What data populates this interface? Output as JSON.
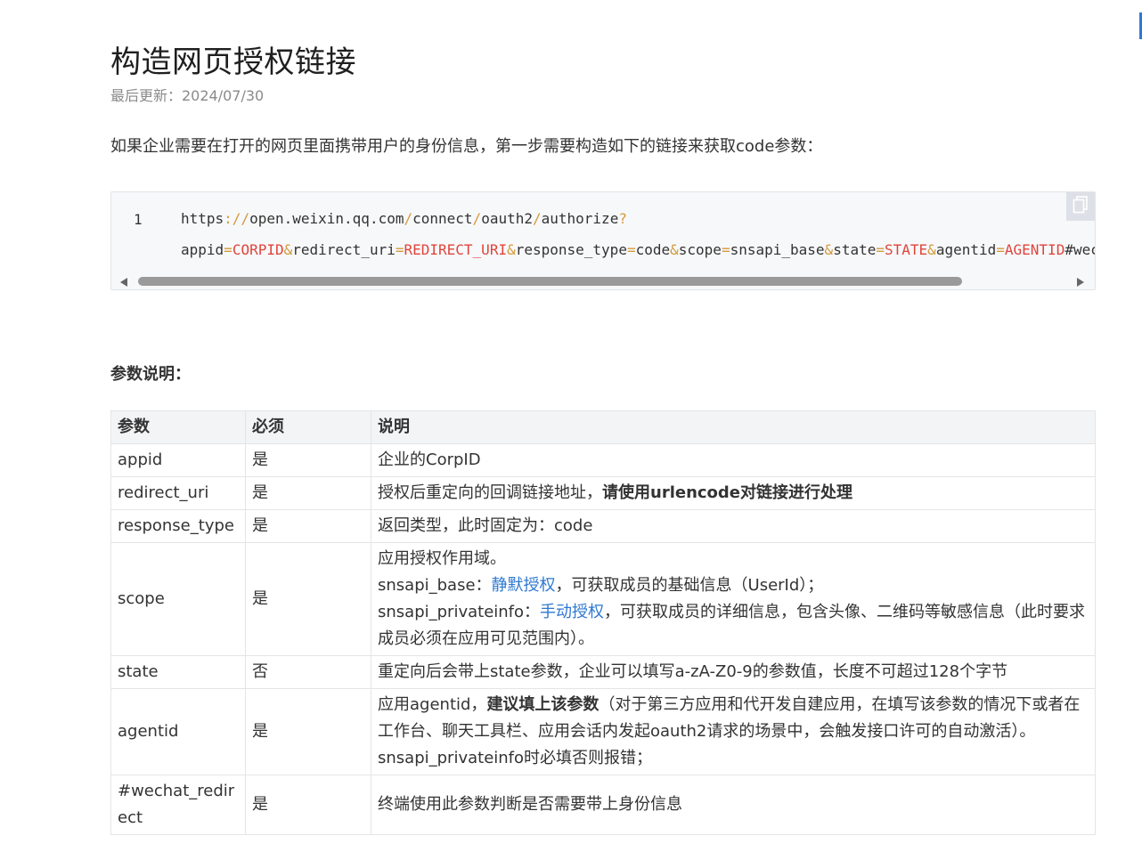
{
  "page": {
    "title": "构造网页授权链接",
    "updated": "最后更新：2024/07/30",
    "intro": "如果企业需要在打开的网页里面携带用户的身份信息，第一步需要构造如下的链接来获取code参数："
  },
  "code": {
    "line_number": "1",
    "line1": [
      {
        "t": "https",
        "k": "n"
      },
      {
        "t": "://",
        "k": "p"
      },
      {
        "t": "open.weixin.qq.com",
        "k": "n"
      },
      {
        "t": "/",
        "k": "p"
      },
      {
        "t": "connect",
        "k": "n"
      },
      {
        "t": "/",
        "k": "p"
      },
      {
        "t": "oauth2",
        "k": "n"
      },
      {
        "t": "/",
        "k": "p"
      },
      {
        "t": "authorize",
        "k": "n"
      },
      {
        "t": "?",
        "k": "p"
      }
    ],
    "line2": [
      {
        "t": "appid",
        "k": "n"
      },
      {
        "t": "=",
        "k": "p"
      },
      {
        "t": "CORPID",
        "k": "v"
      },
      {
        "t": "&",
        "k": "p"
      },
      {
        "t": "redirect_uri",
        "k": "n"
      },
      {
        "t": "=",
        "k": "p"
      },
      {
        "t": "REDIRECT_URI",
        "k": "v"
      },
      {
        "t": "&",
        "k": "p"
      },
      {
        "t": "response_type",
        "k": "n"
      },
      {
        "t": "=",
        "k": "p"
      },
      {
        "t": "code",
        "k": "n"
      },
      {
        "t": "&",
        "k": "p"
      },
      {
        "t": "scope",
        "k": "n"
      },
      {
        "t": "=",
        "k": "p"
      },
      {
        "t": "snsapi_base",
        "k": "n"
      },
      {
        "t": "&",
        "k": "p"
      },
      {
        "t": "state",
        "k": "n"
      },
      {
        "t": "=",
        "k": "p"
      },
      {
        "t": "STATE",
        "k": "v"
      },
      {
        "t": "&",
        "k": "p"
      },
      {
        "t": "agentid",
        "k": "n"
      },
      {
        "t": "=",
        "k": "p"
      },
      {
        "t": "AGENTID",
        "k": "v"
      },
      {
        "t": "#wechat_redirect",
        "k": "n"
      }
    ],
    "copy_icon": "copy-icon"
  },
  "colors": {
    "punct": "#d49a3a",
    "value": "#e0453b",
    "link": "#2e78d2"
  },
  "params": {
    "section_title": "参数说明：",
    "headers": [
      "参数",
      "必须",
      "说明"
    ],
    "rows": [
      {
        "name": "appid",
        "required": "是",
        "desc": [
          {
            "t": "企业的CorpID"
          }
        ]
      },
      {
        "name": "redirect_uri",
        "required": "是",
        "desc": [
          {
            "t": "授权后重定向的回调链接地址，"
          },
          {
            "t": "请使用urlencode对链接进行处理",
            "style": "bold"
          }
        ]
      },
      {
        "name": "response_type",
        "required": "是",
        "desc": [
          {
            "t": "返回类型，此时固定为：code"
          }
        ]
      },
      {
        "name": "scope",
        "required": "是",
        "desc": [
          {
            "t": "应用授权作用域。"
          },
          {
            "br": true
          },
          {
            "t": "snsapi_base："
          },
          {
            "t": "静默授权",
            "style": "link"
          },
          {
            "t": "，可获取成员的基础信息（UserId）；"
          },
          {
            "br": true
          },
          {
            "t": "snsapi_privateinfo："
          },
          {
            "t": "手动授权",
            "style": "link"
          },
          {
            "t": "，可获取成员的详细信息，包含头像、二维码等敏感信息（此时要求成员必须在应用可见范围内）。"
          }
        ]
      },
      {
        "name": "state",
        "required": "否",
        "desc": [
          {
            "t": "重定向后会带上state参数，企业可以填写a-zA-Z0-9的参数值，长度不可超过128个字节"
          }
        ]
      },
      {
        "name": "agentid",
        "required": "是",
        "desc": [
          {
            "t": "应用agentid，"
          },
          {
            "t": "建议填上该参数",
            "style": "bold"
          },
          {
            "t": "（对于第三方应用和代开发自建应用，在填写该参数的情况下或者在工作台、聊天工具栏、应用会话内发起oauth2请求的场景中，会触发接口许可的自动激活）。snsapi_privateinfo时必填否则报错；"
          }
        ]
      },
      {
        "name": "#wechat_redirect",
        "required": "是",
        "desc": [
          {
            "t": "终端使用此参数判断是否需要带上身份信息"
          }
        ]
      }
    ]
  }
}
